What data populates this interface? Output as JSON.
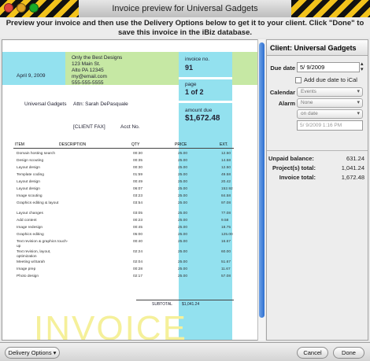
{
  "window": {
    "title": "Invoice preview for Universal Gadgets",
    "instructions": "Preview your invoice and then use the Delivery Options below to get it to your client.  Click \"Done\" to save this invoice in the iBiz database."
  },
  "invoice": {
    "date": "April 9, 2009",
    "from": {
      "company": "Only the Best Designs",
      "street": "123 Main St.",
      "city": "Alto PA 12345",
      "email": "my@email.com",
      "phone": "555-555-5555"
    },
    "invoice_no_label": "invoice no.",
    "invoice_no": "91",
    "page_label": "page",
    "page_value": "1 of 2",
    "amount_due_label": "amount due",
    "amount_due": "$1,672.48",
    "client_name": "Universal Gadgets",
    "attn": "Attn: Sarah DePasquale",
    "client_fax": "[CLIENT FAX]",
    "acct_no": "Acct No.",
    "columns": [
      "ITEM",
      "DESCRIPTION",
      "QTY",
      "PRICE",
      "EXT."
    ],
    "rows": [
      {
        "item": "Domain hosting search",
        "qty": "00:30",
        "price": "25.00",
        "ext": "12.50"
      },
      {
        "item": "Design scouting",
        "qty": "00:35",
        "price": "25.00",
        "ext": "14.58"
      },
      {
        "item": "Layout design",
        "qty": "00:30",
        "price": "25.00",
        "ext": "12.50"
      },
      {
        "item": "Template coding",
        "qty": "01:59",
        "price": "25.00",
        "ext": "49.58"
      },
      {
        "item": "Layout design",
        "qty": "00:49",
        "price": "25.00",
        "ext": "20.42"
      },
      {
        "item": "Layout design",
        "qty": "06:07",
        "price": "25.00",
        "ext": "152.92"
      },
      {
        "item": "Image scouting",
        "qty": "03:23",
        "price": "25.00",
        "ext": "84.58"
      },
      {
        "item": "Graphics editing & layout",
        "qty": "03:54",
        "price": "25.00",
        "ext": "97.08"
      },
      {
        "item": "Layout changes",
        "qty": "03:05",
        "price": "25.00",
        "ext": "77.08"
      },
      {
        "item": "Add content",
        "qty": "00:23",
        "price": "25.00",
        "ext": "9.58"
      },
      {
        "item": "Image redesign",
        "qty": "00:45",
        "price": "25.00",
        "ext": "18.75"
      },
      {
        "item": "Graphics editing",
        "qty": "05:00",
        "price": "25.00",
        "ext": "125.00"
      },
      {
        "item": "Text revision & graphics touch-up",
        "qty": "00:40",
        "price": "25.00",
        "ext": "16.67"
      },
      {
        "item": "Text revision, layout, optimization",
        "qty": "02:24",
        "price": "25.00",
        "ext": "60.00"
      },
      {
        "item": "Meeting w/Sarah",
        "qty": "02:04",
        "price": "25.00",
        "ext": "51.67"
      },
      {
        "item": "Image prep",
        "qty": "00:28",
        "price": "25.00",
        "ext": "11.67"
      },
      {
        "item": "Photo design",
        "qty": "02:17",
        "price": "25.00",
        "ext": "57.08"
      }
    ],
    "subtotal_label": "SUBTOTAL",
    "subtotal": "$1,041.24",
    "watermark": "INVOICE"
  },
  "sidebar": {
    "header": "Client: Universal Gadgets",
    "due_date_label": "Due date",
    "due_date": "5/ 9/2009",
    "add_ical_label": "Add due date to iCal",
    "calendar_label": "Calendar",
    "calendar_value": "Events",
    "alarm_label": "Alarm",
    "alarm_value": "None",
    "alarm_timing": "on date",
    "alarm_datetime": "5/ 9/2009   1:16 PM",
    "unpaid_label": "Unpaid balance:",
    "unpaid_value": "631.24",
    "project_label": "Project(s) total:",
    "project_value": "1,041.24",
    "invoice_total_label": "Invoice total:",
    "invoice_total_value": "1,672.48"
  },
  "bottombar": {
    "delivery_options": "Delivery Options",
    "cancel": "Cancel",
    "done": "Done"
  },
  "colors": {
    "cyan_block": "#93e1ef",
    "green_band": "#c6e8a4",
    "watermark": "#f5f09a",
    "scroll_thumb": "#2d6fd0"
  }
}
